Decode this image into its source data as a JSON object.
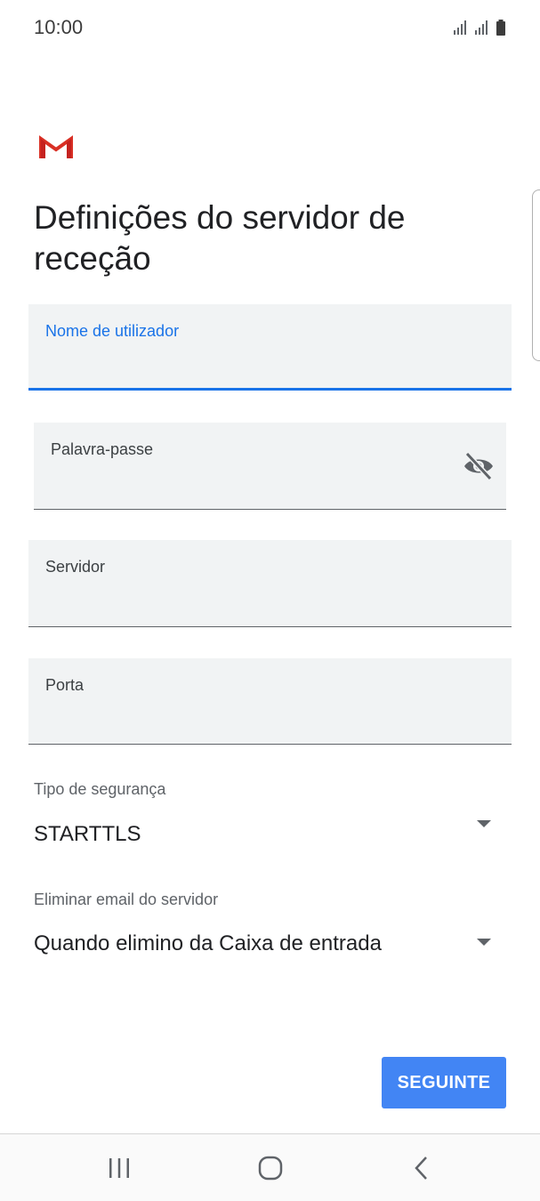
{
  "status_bar": {
    "time": "10:00"
  },
  "app": {
    "logo_icon": "gmail-m-icon"
  },
  "page": {
    "title": "Definições do servidor de receção"
  },
  "fields": {
    "username": {
      "label": "Nome de utilizador",
      "value": ""
    },
    "password": {
      "label": "Palavra-passe",
      "value": "",
      "toggle_icon": "visibility-off-icon"
    },
    "server": {
      "label": "Servidor",
      "value": ""
    },
    "port": {
      "label": "Porta",
      "value": ""
    }
  },
  "security_type": {
    "label": "Tipo de segurança",
    "selected": "STARTTLS"
  },
  "delete_email": {
    "label": "Eliminar email do servidor",
    "selected": "Quando elimino da Caixa de entrada"
  },
  "actions": {
    "next_label": "SEGUINTE"
  },
  "colors": {
    "accent": "#1a73e8",
    "button": "#4285f4",
    "field_bg": "#f1f3f4",
    "gmail_red": "#d93025"
  },
  "nav_bar": {
    "recents_icon": "recents-icon",
    "home_icon": "home-icon",
    "back_icon": "back-icon"
  }
}
